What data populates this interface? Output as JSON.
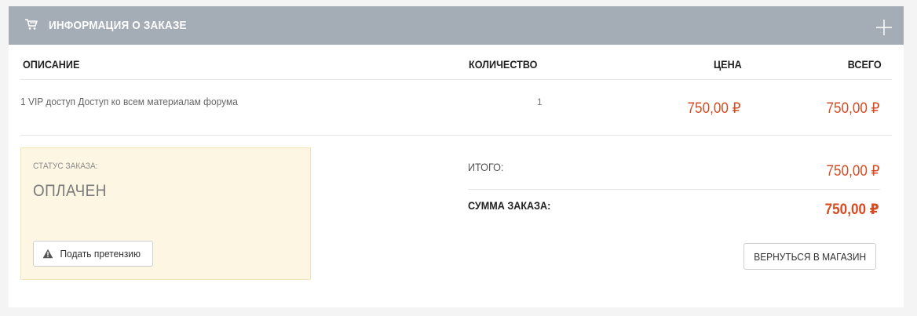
{
  "header": {
    "title": "ИНФОРМАЦИЯ О ЗАКАЗЕ",
    "icon": "shopping-cart-icon",
    "expand_icon": "plus-icon"
  },
  "table": {
    "columns": [
      "ОПИСАНИЕ",
      "КОЛИЧЕСТВО",
      "ЦЕНА",
      "ВСЕГО"
    ],
    "rows": [
      {
        "description": "1 VIP доступ Доступ ко всем материалам форума",
        "quantity": "1",
        "price": "750,00 ₽",
        "total": "750,00 ₽"
      }
    ]
  },
  "status": {
    "label": "СТАТУС ЗАКАЗА:",
    "value": "ОПЛАЧЕН",
    "claim_button": "Подать претензию"
  },
  "totals": {
    "subtotal_label": "ИТОГО:",
    "subtotal_value": "750,00 ₽",
    "sum_label": "СУММА ЗАКАЗА:",
    "sum_value": "750,00 ₽"
  },
  "return_button": "ВЕРНУТЬСЯ В МАГАЗИН",
  "colors": {
    "header_bg": "#a4acb5",
    "price_accent": "#d54b22",
    "status_bg": "#fcf6e2"
  }
}
